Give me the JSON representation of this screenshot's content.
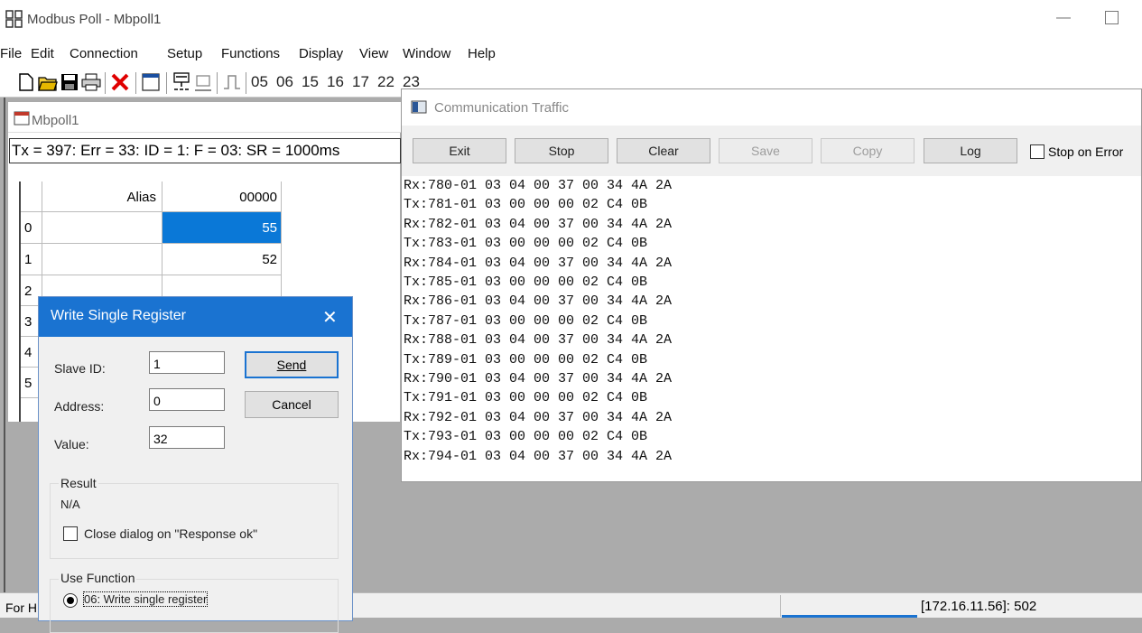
{
  "window": {
    "title": "Modbus Poll - Mbpoll1",
    "minimize": "—"
  },
  "menu": [
    "File",
    "Edit",
    "Connection",
    "Setup",
    "Functions",
    "Display",
    "View",
    "Window",
    "Help"
  ],
  "toolbar": {
    "codes": [
      "05",
      "06",
      "15",
      "16",
      "17",
      "22",
      "23"
    ],
    "tc": "TC"
  },
  "mbpoll": {
    "title": "Mbpoll1",
    "status": "Tx = 397: Err = 33: ID = 1: F = 03: SR = 1000ms",
    "columns": {
      "alias": "Alias",
      "addr": "00000"
    },
    "rows": [
      {
        "idx": "0",
        "value": "55"
      },
      {
        "idx": "1",
        "value": "52"
      },
      {
        "idx": "2",
        "value": ""
      },
      {
        "idx": "3",
        "value": ""
      },
      {
        "idx": "4",
        "value": ""
      },
      {
        "idx": "5",
        "value": ""
      }
    ]
  },
  "dialog": {
    "title": "Write Single Register",
    "close": "✕",
    "slave_label": "Slave ID:",
    "slave_value": "1",
    "address_label": "Address:",
    "address_value": "0",
    "value_label": "Value:",
    "value_value": "32",
    "send": "Send",
    "cancel": "Cancel",
    "result_title": "Result",
    "result_value": "N/A",
    "close_on_ok": "Close dialog on \"Response ok\"",
    "use_function": "Use Function",
    "function_option": "06: Write single register"
  },
  "traffic": {
    "title": "Communication Traffic",
    "buttons": {
      "exit": "Exit",
      "stop": "Stop",
      "clear": "Clear",
      "save": "Save",
      "copy": "Copy",
      "log": "Log"
    },
    "stop_on_error": "Stop on Error",
    "lines": [
      "Rx:780-01 03 04 00 37 00 34 4A 2A",
      "Tx:781-01 03 00 00 00 02 C4 0B",
      "Rx:782-01 03 04 00 37 00 34 4A 2A",
      "Tx:783-01 03 00 00 00 02 C4 0B",
      "Rx:784-01 03 04 00 37 00 34 4A 2A",
      "Tx:785-01 03 00 00 00 02 C4 0B",
      "Rx:786-01 03 04 00 37 00 34 4A 2A",
      "Tx:787-01 03 00 00 00 02 C4 0B",
      "Rx:788-01 03 04 00 37 00 34 4A 2A",
      "Tx:789-01 03 00 00 00 02 C4 0B",
      "Rx:790-01 03 04 00 37 00 34 4A 2A",
      "Tx:791-01 03 00 00 00 02 C4 0B",
      "Rx:792-01 03 04 00 37 00 34 4A 2A",
      "Tx:793-01 03 00 00 00 02 C4 0B",
      "Rx:794-01 03 04 00 37 00 34 4A 2A"
    ]
  },
  "statusbar": {
    "left": "For H",
    "right": "[172.16.11.56]: 502"
  },
  "colors": {
    "accent": "#1a73d1",
    "selected_cell": "#0a78d7",
    "workspace": "#ababab"
  }
}
